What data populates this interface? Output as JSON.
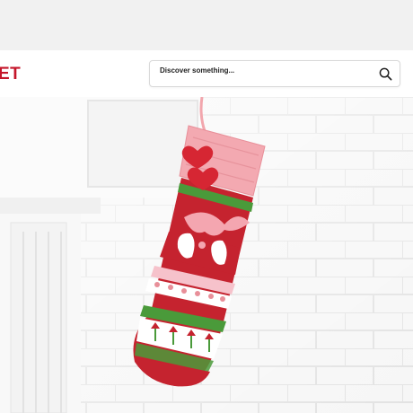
{
  "header": {
    "logo_text": "ET",
    "search": {
      "placeholder": "Discover something..."
    }
  },
  "hero": {
    "image": "knit-christmas-stocking-with-swans-and-hearts"
  },
  "colors": {
    "brand": "#c4162a",
    "header_bg": "#ffffff",
    "banner_bg": "#f1f1f1"
  }
}
